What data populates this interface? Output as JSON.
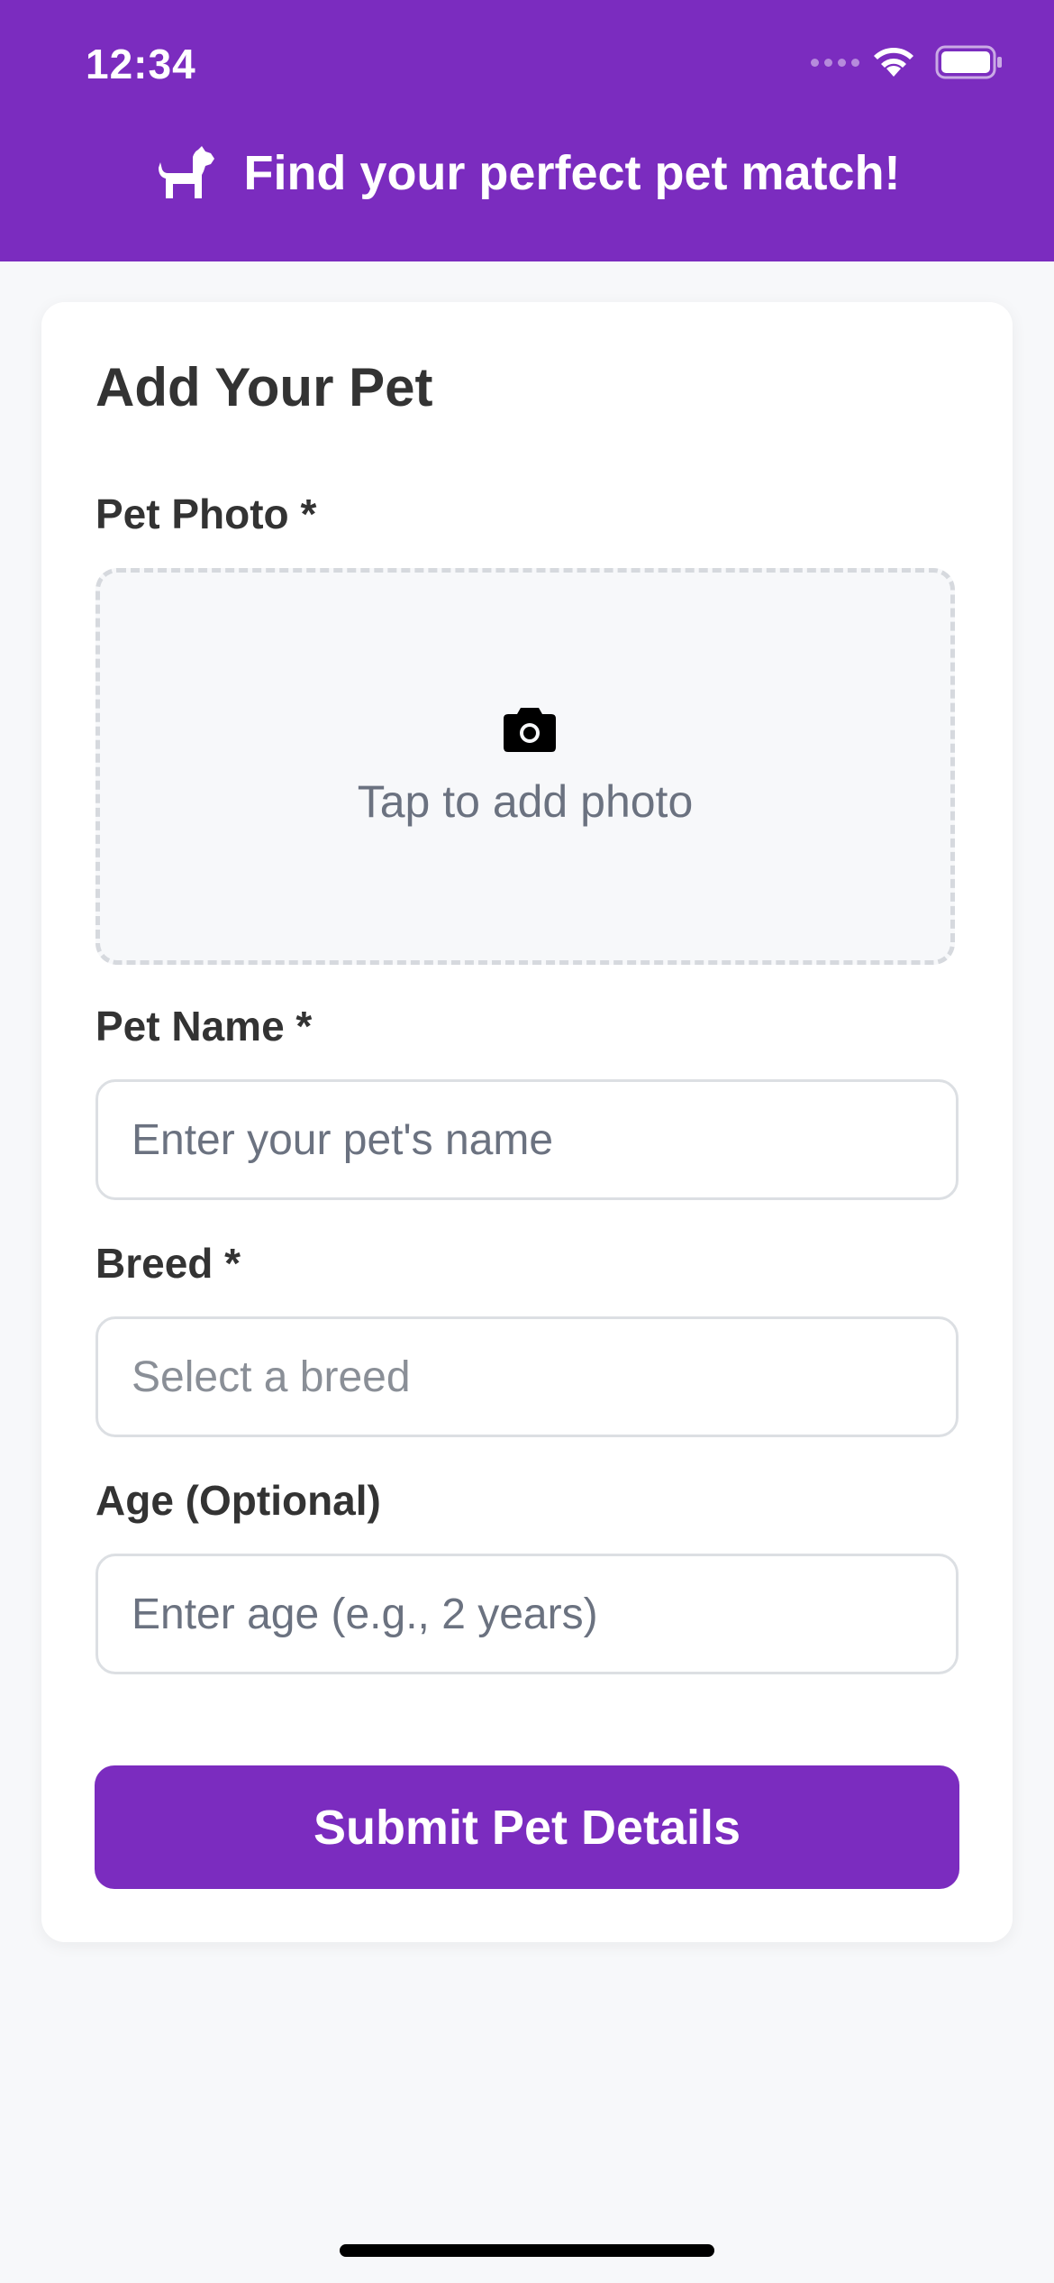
{
  "status_bar": {
    "time": "12:34"
  },
  "header": {
    "title": "Find your perfect pet match!",
    "icon": "dog-icon",
    "background_color": "#7b2cbf"
  },
  "form": {
    "title": "Add Your Pet",
    "photo": {
      "label": "Pet Photo *",
      "prompt": "Tap to add photo",
      "icon": "camera-icon"
    },
    "name": {
      "label": "Pet Name *",
      "placeholder": "Enter your pet's name"
    },
    "breed": {
      "label": "Breed *",
      "placeholder": "Select a breed"
    },
    "age": {
      "label": "Age (Optional)",
      "placeholder": "Enter age (e.g., 2 years)"
    },
    "submit_label": "Submit Pet Details"
  },
  "colors": {
    "accent": "#7b2cbf",
    "background": "#f7f8fa",
    "card": "#ffffff"
  }
}
